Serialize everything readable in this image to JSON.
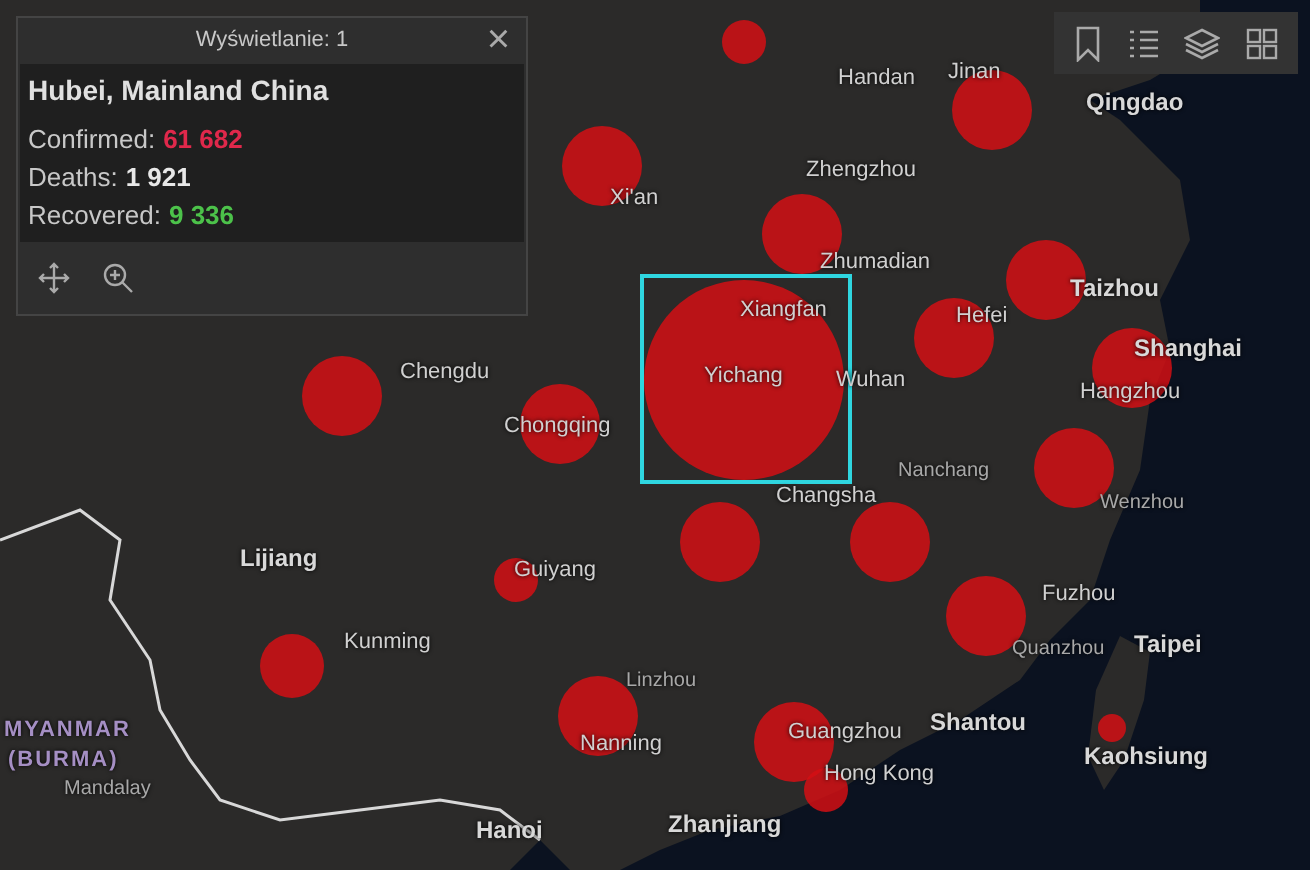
{
  "popup": {
    "header": "Wyświetlanie: 1",
    "close": "×",
    "title": "Hubei, Mainland China",
    "fields": [
      {
        "label": "Confirmed:",
        "value": "61 682",
        "kind": "confirmed"
      },
      {
        "label": "Deaths:",
        "value": "1 921",
        "kind": "deaths"
      },
      {
        "label": "Recovered:",
        "value": "9 336",
        "kind": "recovered"
      }
    ]
  },
  "map_labels": [
    {
      "text": "Handan",
      "kind": "city"
    },
    {
      "text": "Jinan",
      "kind": "city"
    },
    {
      "text": "Qingdao",
      "kind": "major"
    },
    {
      "text": "Zhengzhou",
      "kind": "city"
    },
    {
      "text": "Xi'an",
      "kind": "city"
    },
    {
      "text": "Zhumadian",
      "kind": "city"
    },
    {
      "text": "Xiangfan",
      "kind": "city"
    },
    {
      "text": "Yichang",
      "kind": "city"
    },
    {
      "text": "Wuhan",
      "kind": "city"
    },
    {
      "text": "Hefei",
      "kind": "city"
    },
    {
      "text": "Taizhou",
      "kind": "major"
    },
    {
      "text": "Shanghai",
      "kind": "major"
    },
    {
      "text": "Hangzhou",
      "kind": "city"
    },
    {
      "text": "Chengdu",
      "kind": "city"
    },
    {
      "text": "Chongqing",
      "kind": "city"
    },
    {
      "text": "Lijiang",
      "kind": "major"
    },
    {
      "text": "Guiyang",
      "kind": "city"
    },
    {
      "text": "Kunming",
      "kind": "city"
    },
    {
      "text": "Linzhou",
      "kind": "small"
    },
    {
      "text": "Nanning",
      "kind": "city"
    },
    {
      "text": "Changsha",
      "kind": "city"
    },
    {
      "text": "Nanchang",
      "kind": "small"
    },
    {
      "text": "Wenzhou",
      "kind": "small"
    },
    {
      "text": "Fuzhou",
      "kind": "city"
    },
    {
      "text": "Quanzhou",
      "kind": "small"
    },
    {
      "text": "Taipei",
      "kind": "major"
    },
    {
      "text": "Shantou",
      "kind": "major"
    },
    {
      "text": "Guangzhou",
      "kind": "city"
    },
    {
      "text": "Hong Kong",
      "kind": "city"
    },
    {
      "text": "Kaohsiung",
      "kind": "major"
    },
    {
      "text": "Zhanjiang",
      "kind": "major"
    },
    {
      "text": "Hanoi",
      "kind": "major"
    },
    {
      "text": "MYANMAR",
      "kind": "country"
    },
    {
      "text": "(BURMA)",
      "kind": "country"
    },
    {
      "text": "Mandalay",
      "kind": "small"
    }
  ]
}
